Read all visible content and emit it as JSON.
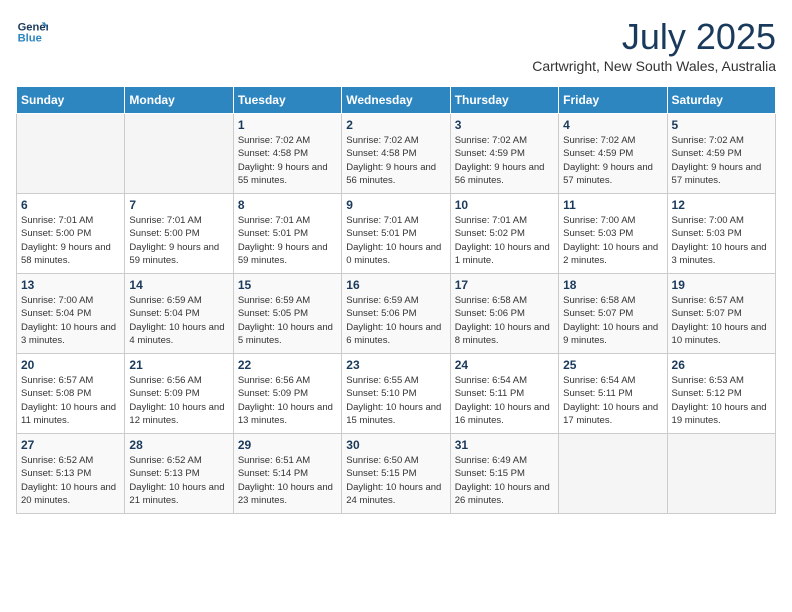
{
  "logo": {
    "line1": "General",
    "line2": "Blue"
  },
  "title": "July 2025",
  "subtitle": "Cartwright, New South Wales, Australia",
  "days_of_week": [
    "Sunday",
    "Monday",
    "Tuesday",
    "Wednesday",
    "Thursday",
    "Friday",
    "Saturday"
  ],
  "weeks": [
    [
      {
        "day": "",
        "info": ""
      },
      {
        "day": "",
        "info": ""
      },
      {
        "day": "1",
        "info": "Sunrise: 7:02 AM\nSunset: 4:58 PM\nDaylight: 9 hours and 55 minutes."
      },
      {
        "day": "2",
        "info": "Sunrise: 7:02 AM\nSunset: 4:58 PM\nDaylight: 9 hours and 56 minutes."
      },
      {
        "day": "3",
        "info": "Sunrise: 7:02 AM\nSunset: 4:59 PM\nDaylight: 9 hours and 56 minutes."
      },
      {
        "day": "4",
        "info": "Sunrise: 7:02 AM\nSunset: 4:59 PM\nDaylight: 9 hours and 57 minutes."
      },
      {
        "day": "5",
        "info": "Sunrise: 7:02 AM\nSunset: 4:59 PM\nDaylight: 9 hours and 57 minutes."
      }
    ],
    [
      {
        "day": "6",
        "info": "Sunrise: 7:01 AM\nSunset: 5:00 PM\nDaylight: 9 hours and 58 minutes."
      },
      {
        "day": "7",
        "info": "Sunrise: 7:01 AM\nSunset: 5:00 PM\nDaylight: 9 hours and 59 minutes."
      },
      {
        "day": "8",
        "info": "Sunrise: 7:01 AM\nSunset: 5:01 PM\nDaylight: 9 hours and 59 minutes."
      },
      {
        "day": "9",
        "info": "Sunrise: 7:01 AM\nSunset: 5:01 PM\nDaylight: 10 hours and 0 minutes."
      },
      {
        "day": "10",
        "info": "Sunrise: 7:01 AM\nSunset: 5:02 PM\nDaylight: 10 hours and 1 minute."
      },
      {
        "day": "11",
        "info": "Sunrise: 7:00 AM\nSunset: 5:03 PM\nDaylight: 10 hours and 2 minutes."
      },
      {
        "day": "12",
        "info": "Sunrise: 7:00 AM\nSunset: 5:03 PM\nDaylight: 10 hours and 3 minutes."
      }
    ],
    [
      {
        "day": "13",
        "info": "Sunrise: 7:00 AM\nSunset: 5:04 PM\nDaylight: 10 hours and 3 minutes."
      },
      {
        "day": "14",
        "info": "Sunrise: 6:59 AM\nSunset: 5:04 PM\nDaylight: 10 hours and 4 minutes."
      },
      {
        "day": "15",
        "info": "Sunrise: 6:59 AM\nSunset: 5:05 PM\nDaylight: 10 hours and 5 minutes."
      },
      {
        "day": "16",
        "info": "Sunrise: 6:59 AM\nSunset: 5:06 PM\nDaylight: 10 hours and 6 minutes."
      },
      {
        "day": "17",
        "info": "Sunrise: 6:58 AM\nSunset: 5:06 PM\nDaylight: 10 hours and 8 minutes."
      },
      {
        "day": "18",
        "info": "Sunrise: 6:58 AM\nSunset: 5:07 PM\nDaylight: 10 hours and 9 minutes."
      },
      {
        "day": "19",
        "info": "Sunrise: 6:57 AM\nSunset: 5:07 PM\nDaylight: 10 hours and 10 minutes."
      }
    ],
    [
      {
        "day": "20",
        "info": "Sunrise: 6:57 AM\nSunset: 5:08 PM\nDaylight: 10 hours and 11 minutes."
      },
      {
        "day": "21",
        "info": "Sunrise: 6:56 AM\nSunset: 5:09 PM\nDaylight: 10 hours and 12 minutes."
      },
      {
        "day": "22",
        "info": "Sunrise: 6:56 AM\nSunset: 5:09 PM\nDaylight: 10 hours and 13 minutes."
      },
      {
        "day": "23",
        "info": "Sunrise: 6:55 AM\nSunset: 5:10 PM\nDaylight: 10 hours and 15 minutes."
      },
      {
        "day": "24",
        "info": "Sunrise: 6:54 AM\nSunset: 5:11 PM\nDaylight: 10 hours and 16 minutes."
      },
      {
        "day": "25",
        "info": "Sunrise: 6:54 AM\nSunset: 5:11 PM\nDaylight: 10 hours and 17 minutes."
      },
      {
        "day": "26",
        "info": "Sunrise: 6:53 AM\nSunset: 5:12 PM\nDaylight: 10 hours and 19 minutes."
      }
    ],
    [
      {
        "day": "27",
        "info": "Sunrise: 6:52 AM\nSunset: 5:13 PM\nDaylight: 10 hours and 20 minutes."
      },
      {
        "day": "28",
        "info": "Sunrise: 6:52 AM\nSunset: 5:13 PM\nDaylight: 10 hours and 21 minutes."
      },
      {
        "day": "29",
        "info": "Sunrise: 6:51 AM\nSunset: 5:14 PM\nDaylight: 10 hours and 23 minutes."
      },
      {
        "day": "30",
        "info": "Sunrise: 6:50 AM\nSunset: 5:15 PM\nDaylight: 10 hours and 24 minutes."
      },
      {
        "day": "31",
        "info": "Sunrise: 6:49 AM\nSunset: 5:15 PM\nDaylight: 10 hours and 26 minutes."
      },
      {
        "day": "",
        "info": ""
      },
      {
        "day": "",
        "info": ""
      }
    ]
  ]
}
